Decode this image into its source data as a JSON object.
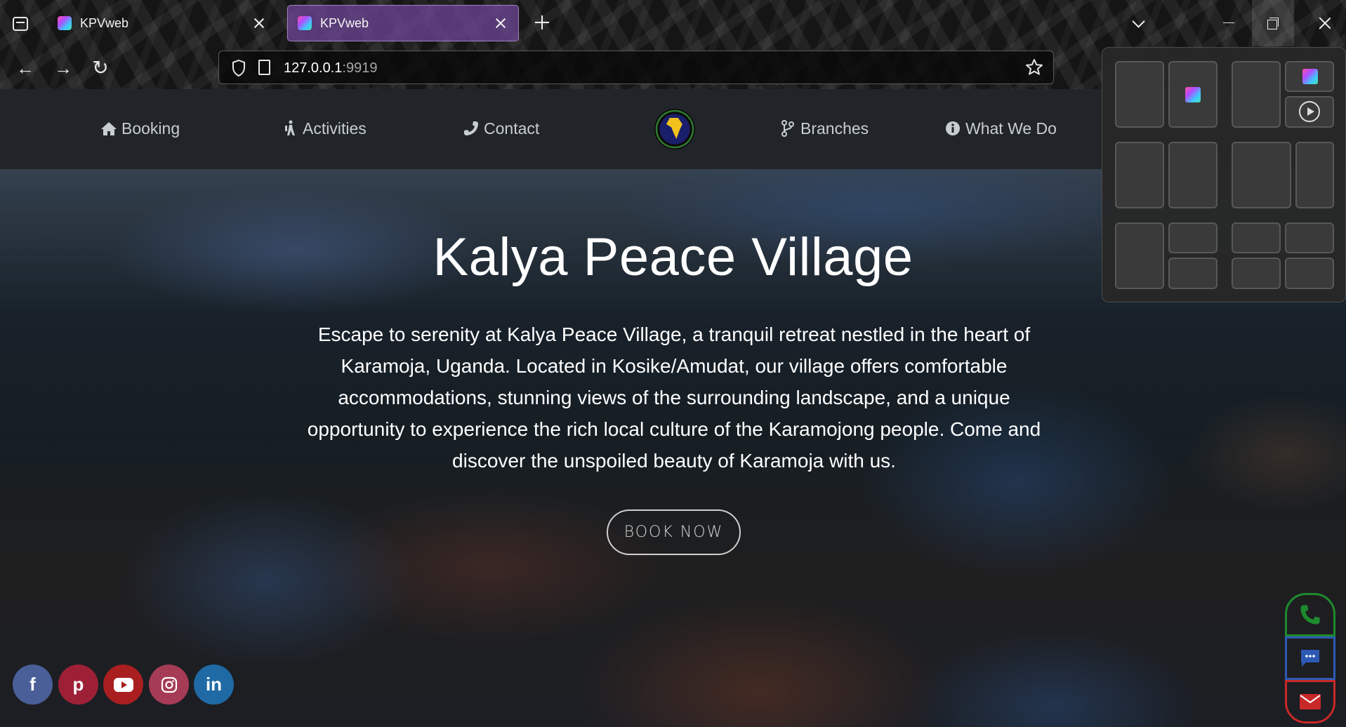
{
  "browser": {
    "tabs": [
      {
        "title": "KPVweb",
        "active": false
      },
      {
        "title": "KPVweb",
        "active": true
      }
    ],
    "url": {
      "host": "127.0.0.1",
      "port": ":9919"
    },
    "icons": {
      "tab_list": "tab-list-icon",
      "new_tab": "plus-icon",
      "back": "arrow-left-icon",
      "forward": "arrow-right-icon",
      "reload": "reload-icon",
      "security": "shield-icon",
      "page": "page-icon",
      "bookmark": "star-icon"
    }
  },
  "site_nav": {
    "items": [
      {
        "label": "Booking",
        "icon": "home-icon"
      },
      {
        "label": "Activities",
        "icon": "hiking-icon"
      },
      {
        "label": "Contact",
        "icon": "phone-icon"
      },
      {
        "label": "Branches",
        "icon": "branch-icon"
      },
      {
        "label": "What We Do",
        "icon": "info-icon"
      }
    ],
    "logo": "africa-logo"
  },
  "hero": {
    "title": "Kalya Peace Village",
    "description": "Escape to serenity at Kalya Peace Village, a tranquil retreat nestled in the heart of Karamoja, Uganda. Located in Kosike/Amudat, our village offers comfortable accommodations, stunning views of the surrounding landscape, and a unique opportunity to experience the rich local culture of the Karamojong people. Come and discover the unspoiled beauty of Karamoja with us.",
    "cta": "BOOK NOW"
  },
  "social": [
    {
      "name": "facebook",
      "glyph": "f",
      "color": "#4a5f97"
    },
    {
      "name": "pinterest",
      "glyph": "p",
      "color": "#9d2036"
    },
    {
      "name": "youtube",
      "glyph": "▶",
      "color": "#a91f1f"
    },
    {
      "name": "instagram",
      "glyph": "◎",
      "color": "#a63b55"
    },
    {
      "name": "linkedin",
      "glyph": "in",
      "color": "#1f6aa5"
    }
  ],
  "contact_buttons": [
    {
      "name": "phone",
      "color": "#1e8a2e"
    },
    {
      "name": "chat",
      "color": "#2d59b5"
    },
    {
      "name": "mail",
      "color": "#c82828"
    }
  ],
  "snap_layouts": {
    "layouts": [
      "two-column-equal",
      "two-column-split",
      "two-column-wide",
      "three-column",
      "main-plus-stack",
      "four-grid"
    ]
  }
}
